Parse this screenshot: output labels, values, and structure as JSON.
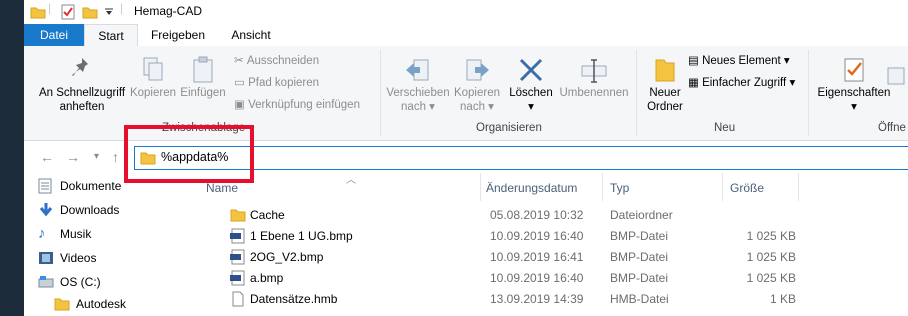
{
  "window": {
    "title": "Hemag-CAD"
  },
  "tabs": [
    "Datei",
    "Start",
    "Freigeben",
    "Ansicht"
  ],
  "ribbon": {
    "pin_label_1": "An Schnellzugriff",
    "pin_label_2": "anheften",
    "copy": "Kopieren",
    "paste": "Einfügen",
    "cut": "Ausschneiden",
    "copy_path": "Pfad kopieren",
    "paste_link": "Verknüpfung einfügen",
    "clipboard_group": "Zwischenablage",
    "move_to_1": "Verschieben",
    "move_to_2": "nach",
    "copy_to_1": "Kopieren",
    "copy_to_2": "nach",
    "delete": "Löschen",
    "rename": "Umbenennen",
    "organize_group": "Organisieren",
    "new_folder_1": "Neuer",
    "new_folder_2": "Ordner",
    "new_item": "Neues Element",
    "easy_access": "Einfacher Zugriff",
    "new_group": "Neu",
    "properties": "Eigenschaften",
    "open_group": "Öffne"
  },
  "address": {
    "value": "%appdata%"
  },
  "nav_pane": [
    "Dokumente",
    "Downloads",
    "Musik",
    "Videos",
    "OS (C:)",
    "Autodesk"
  ],
  "columns": [
    "Name",
    "Änderungsdatum",
    "Typ",
    "Größe"
  ],
  "files": [
    {
      "name": "Cache",
      "date": "05.08.2019 10:32",
      "type": "Dateiordner",
      "size": "",
      "icon": "folder-icon"
    },
    {
      "name": "1 Ebene 1 UG.bmp",
      "date": "10.09.2019 16:40",
      "type": "BMP-Datei",
      "size": "1 025 KB",
      "icon": "bmp-file-icon"
    },
    {
      "name": "2OG_V2.bmp",
      "date": "10.09.2019 16:41",
      "type": "BMP-Datei",
      "size": "1 025 KB",
      "icon": "bmp-file-icon"
    },
    {
      "name": "a.bmp",
      "date": "10.09.2019 16:40",
      "type": "BMP-Datei",
      "size": "1 025 KB",
      "icon": "bmp-file-icon"
    },
    {
      "name": "Datensätze.hmb",
      "date": "13.09.2019 14:39",
      "type": "HMB-Datei",
      "size": "1 KB",
      "icon": "document-icon"
    }
  ],
  "colors": {
    "accent": "#1979ca",
    "highlight_box": "#e5102e",
    "folder": "#f5c342"
  }
}
